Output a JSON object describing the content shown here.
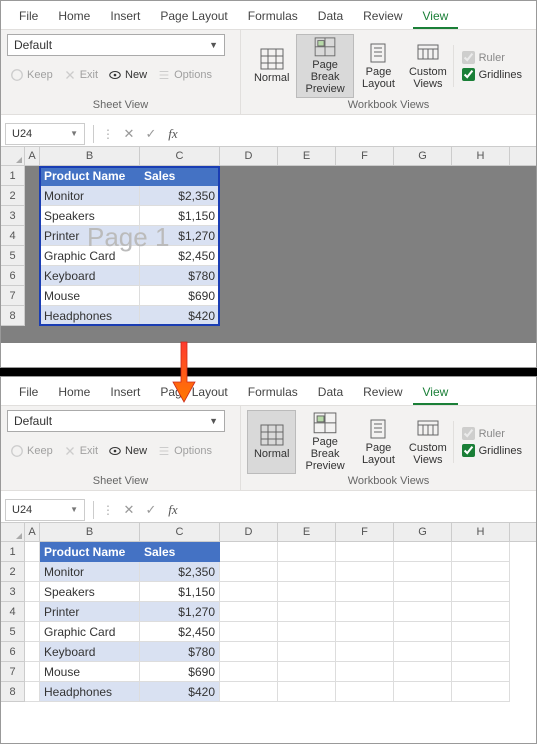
{
  "tabs": [
    "File",
    "Home",
    "Insert",
    "Page Layout",
    "Formulas",
    "Data",
    "Review",
    "View"
  ],
  "active_tab": "View",
  "sheet_view": {
    "dropdown_value": "Default",
    "buttons": {
      "keep": "Keep",
      "exit": "Exit",
      "new": "New",
      "options": "Options"
    },
    "group_label": "Sheet View"
  },
  "workbook_views": {
    "normal": "Normal",
    "page_break": "Page Break Preview",
    "page_layout": "Page Layout",
    "custom_views": "Custom Views",
    "group_label": "Workbook Views"
  },
  "show": {
    "ruler": "Ruler",
    "gridlines": "Gridlines"
  },
  "namebox": "U24",
  "columns": [
    "A",
    "B",
    "C",
    "D",
    "E",
    "F",
    "G",
    "H"
  ],
  "headers": {
    "b": "Product Name",
    "c": "Sales"
  },
  "rows": [
    {
      "n": "1",
      "b": "Product Name",
      "c": "Sales",
      "hdr": true
    },
    {
      "n": "2",
      "b": "Monitor",
      "c": "$2,350",
      "band": true
    },
    {
      "n": "3",
      "b": "Speakers",
      "c": "$1,150"
    },
    {
      "n": "4",
      "b": "Printer",
      "c": "$1,270",
      "band": true
    },
    {
      "n": "5",
      "b": "Graphic Card",
      "c": "$2,450"
    },
    {
      "n": "6",
      "b": "Keyboard",
      "c": "$780",
      "band": true
    },
    {
      "n": "7",
      "b": "Mouse",
      "c": "$690"
    },
    {
      "n": "8",
      "b": "Headphones",
      "c": "$420",
      "band": true
    }
  ],
  "page_watermark": "Page 1",
  "chart_data": {
    "type": "table",
    "title": "",
    "columns": [
      "Product Name",
      "Sales"
    ],
    "rows": [
      [
        "Monitor",
        2350
      ],
      [
        "Speakers",
        1150
      ],
      [
        "Printer",
        1270
      ],
      [
        "Graphic Card",
        2450
      ],
      [
        "Keyboard",
        780
      ],
      [
        "Mouse",
        690
      ],
      [
        "Headphones",
        420
      ]
    ]
  }
}
